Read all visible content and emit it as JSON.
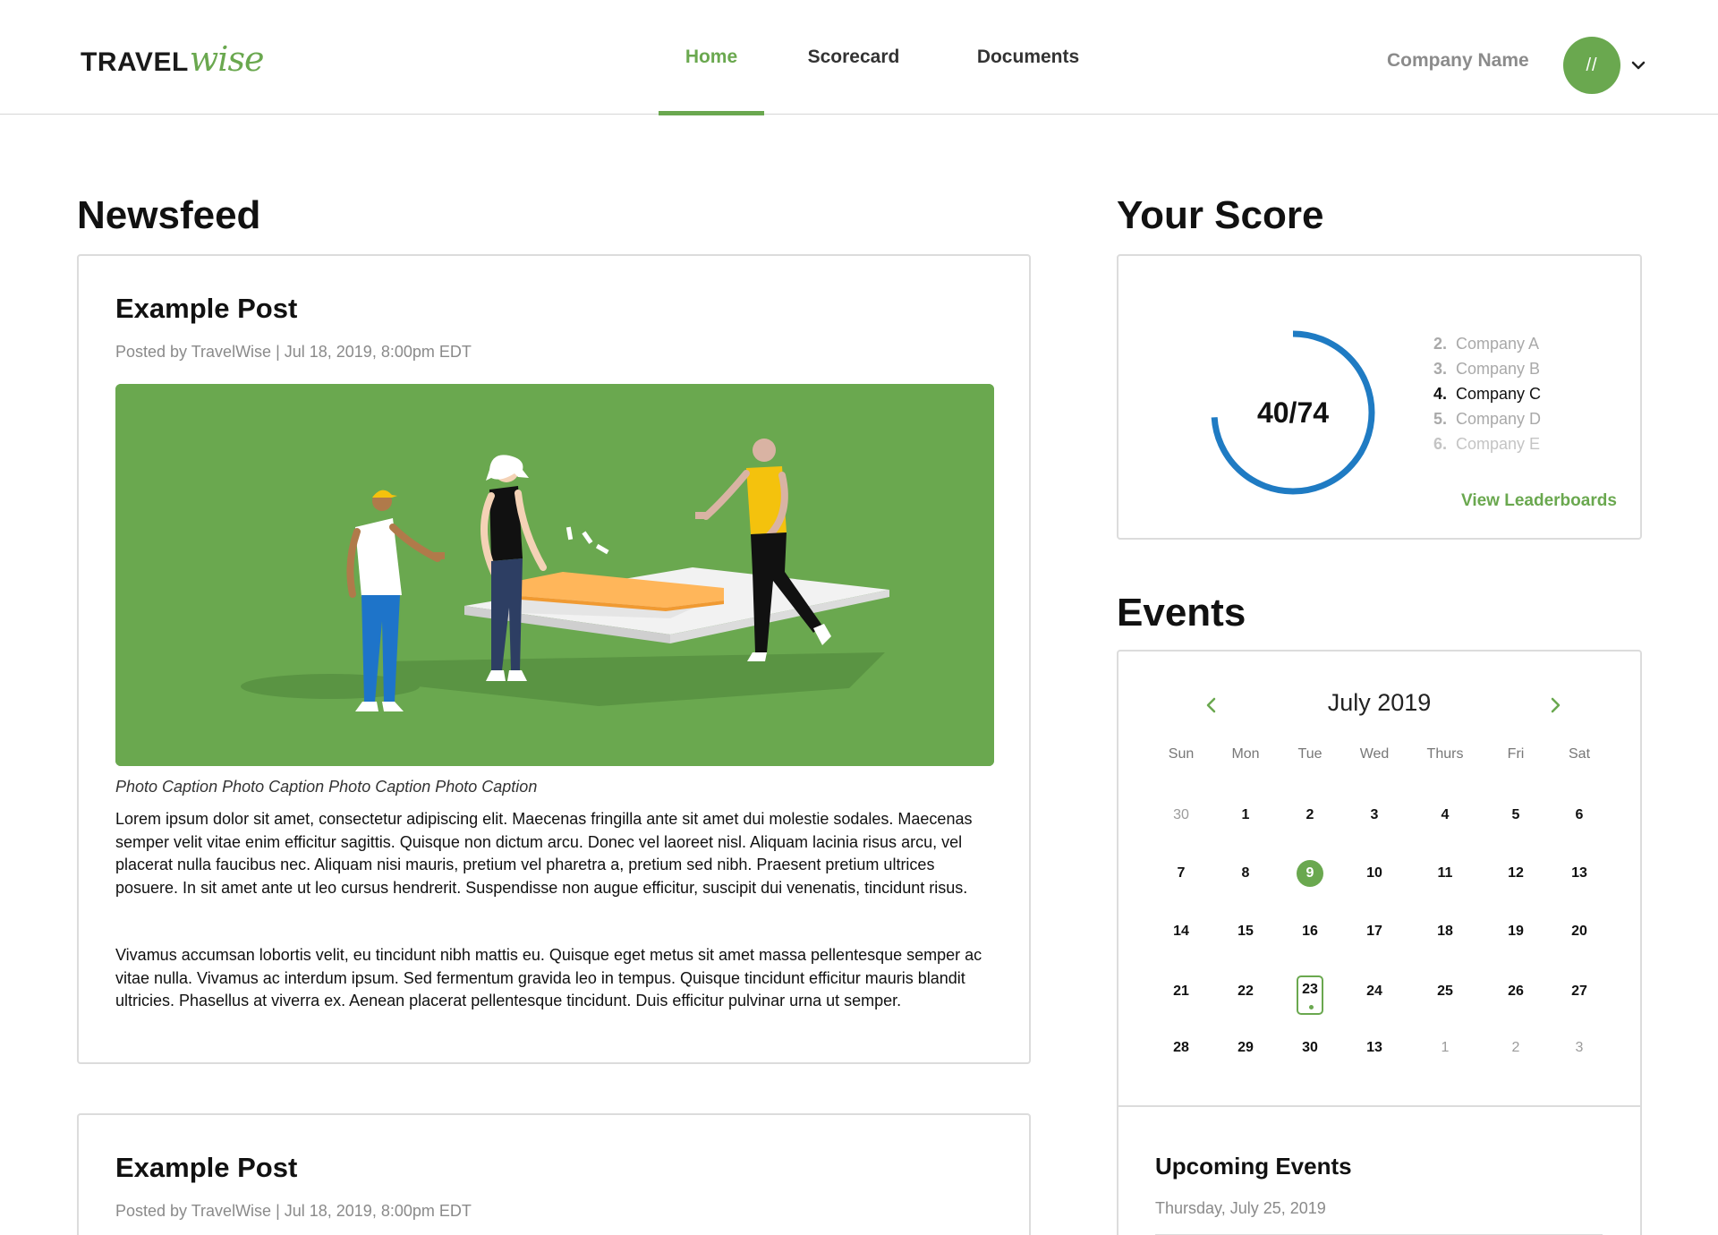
{
  "brand": {
    "part1": "TRAVEL",
    "part2": "wise",
    "accent": "#6aa84f"
  },
  "nav": {
    "tabs": [
      {
        "label": "Home",
        "active": true
      },
      {
        "label": "Scorecard",
        "active": false
      },
      {
        "label": "Documents",
        "active": false
      }
    ]
  },
  "account": {
    "company_name": "Company Name",
    "avatar_text": "//",
    "menu_icon": "chevron-down-icon"
  },
  "newsfeed": {
    "title": "Newsfeed",
    "posts": [
      {
        "title": "Example Post",
        "meta": "Posted by TravelWise | Jul 18, 2019, 8:00pm EDT",
        "caption": "Photo Caption Photo Caption Photo Caption Photo Caption",
        "paragraphs": [
          "Lorem ipsum dolor sit amet, consectetur adipiscing elit. Maecenas fringilla ante sit amet dui molestie sodales. Maecenas semper velit vitae enim efficitur sagittis. Quisque non dictum arcu. Donec vel laoreet nisl. Aliquam lacinia risus arcu, vel placerat nulla faucibus nec. Aliquam nisi mauris, pretium vel pharetra a, pretium sed nibh. Praesent pretium ultrices posuere. In sit amet ante ut leo cursus hendrerit. Suspendisse non augue efficitur, suscipit dui venenatis, tincidunt risus.",
          "Vivamus accumsan lobortis velit, eu tincidunt nibh mattis eu. Quisque eget metus sit amet massa pellentesque semper ac vitae nulla. Vivamus ac interdum ipsum. Sed fermentum gravida leo in tempus. Quisque tincidunt efficitur mauris blandit ultricies. Phasellus at viverra ex. Aenean placerat pellentesque tincidunt. Duis efficitur pulvinar urna ut semper."
        ]
      },
      {
        "title": "Example Post",
        "meta": "Posted by TravelWise | Jul 18, 2019, 8:00pm EDT"
      }
    ]
  },
  "score": {
    "title": "Your Score",
    "value_text": "40/74",
    "ring_fraction": 0.74,
    "ring_color": "#1f7bc3",
    "leaderboard": [
      {
        "rank": "2.",
        "name": "Company A",
        "current": false
      },
      {
        "rank": "3.",
        "name": "Company B",
        "current": false
      },
      {
        "rank": "4.",
        "name": "Company C",
        "current": true
      },
      {
        "rank": "5.",
        "name": "Company D",
        "current": false
      },
      {
        "rank": "6.",
        "name": "Company E",
        "current": false
      }
    ],
    "link": "View Leaderboards"
  },
  "events": {
    "title": "Events",
    "month": "July 2019",
    "weekdays": [
      "Sun",
      "Mon",
      "Tue",
      "Wed",
      "Thurs",
      "Fri",
      "Sat"
    ],
    "weeks": [
      [
        {
          "d": "30",
          "m": true
        },
        {
          "d": "1"
        },
        {
          "d": "2"
        },
        {
          "d": "3"
        },
        {
          "d": "4"
        },
        {
          "d": "5"
        },
        {
          "d": "6"
        }
      ],
      [
        {
          "d": "7"
        },
        {
          "d": "8"
        },
        {
          "d": "9",
          "today": true
        },
        {
          "d": "10"
        },
        {
          "d": "11"
        },
        {
          "d": "12"
        },
        {
          "d": "13"
        }
      ],
      [
        {
          "d": "14"
        },
        {
          "d": "15"
        },
        {
          "d": "16"
        },
        {
          "d": "17"
        },
        {
          "d": "18"
        },
        {
          "d": "19"
        },
        {
          "d": "20"
        }
      ],
      [
        {
          "d": "21"
        },
        {
          "d": "22"
        },
        {
          "d": "23",
          "event": true
        },
        {
          "d": "24"
        },
        {
          "d": "25"
        },
        {
          "d": "26"
        },
        {
          "d": "27"
        }
      ],
      [
        {
          "d": "28"
        },
        {
          "d": "29"
        },
        {
          "d": "30"
        },
        {
          "d": "13"
        },
        {
          "d": "1",
          "m": true
        },
        {
          "d": "2",
          "m": true
        },
        {
          "d": "3",
          "m": true
        }
      ]
    ],
    "upcoming_title": "Upcoming Events",
    "upcoming_date": "Thursday, July 25, 2019"
  }
}
